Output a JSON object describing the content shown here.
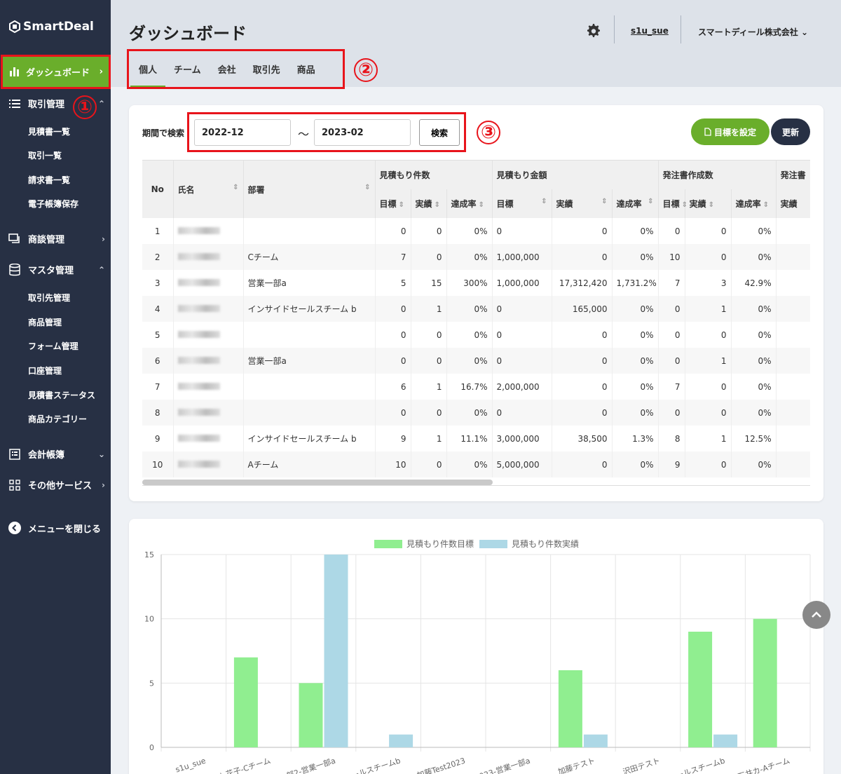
{
  "app": {
    "logo": "SmartDeal"
  },
  "sidebar": {
    "dashboard": "ダッシュボード",
    "deals_mgmt": "取引管理",
    "deals_subs": [
      "見積書一覧",
      "取引一覧",
      "請求書一覧",
      "電子帳簿保存"
    ],
    "negotiation": "商談管理",
    "master": "マスタ管理",
    "master_subs": [
      "取引先管理",
      "商品管理",
      "フォーム管理",
      "口座管理",
      "見積書ステータス",
      "商品カテゴリー"
    ],
    "accounting": "会計帳簿",
    "other": "その他サービス",
    "close": "メニューを閉じる"
  },
  "annotations": {
    "n1": "①",
    "n2": "②",
    "n3": "③"
  },
  "header": {
    "title": "ダッシュボード",
    "user": "s1u_sue",
    "company": "スマートディール株式会社"
  },
  "tabs": [
    "個人",
    "チーム",
    "会社",
    "取引先",
    "商品"
  ],
  "filter": {
    "label": "期間で検索",
    "from": "2022-12",
    "tilde": "〜",
    "to": "2023-02",
    "search": "検索",
    "goal": "目標を設定",
    "update": "更新"
  },
  "table": {
    "h_no": "No",
    "h_name": "氏名",
    "h_dept": "部署",
    "groups": [
      "見積もり件数",
      "見積もり金額",
      "発注書作成数",
      "発注書"
    ],
    "sub": [
      "目標",
      "実績",
      "達成率",
      "目標",
      "実績",
      "達成率",
      "目標",
      "実績",
      "達成率",
      "実績"
    ],
    "rows": [
      {
        "no": "1",
        "dept": "",
        "c": [
          "0",
          "0",
          "0%",
          "0",
          "0",
          "0%",
          "0",
          "0",
          "0%",
          ""
        ]
      },
      {
        "no": "2",
        "dept": "Cチーム",
        "c": [
          "7",
          "0",
          "0%",
          "1,000,000",
          "0",
          "0%",
          "10",
          "0",
          "0%",
          ""
        ]
      },
      {
        "no": "3",
        "dept": "営業一部a",
        "c": [
          "5",
          "15",
          "300%",
          "1,000,000",
          "17,312,420",
          "1,731.2%",
          "7",
          "3",
          "42.9%",
          ""
        ]
      },
      {
        "no": "4",
        "dept": "インサイドセールスチーム b",
        "c": [
          "0",
          "1",
          "0%",
          "0",
          "165,000",
          "0%",
          "0",
          "1",
          "0%",
          ""
        ]
      },
      {
        "no": "5",
        "dept": "",
        "c": [
          "0",
          "0",
          "0%",
          "0",
          "0",
          "0%",
          "0",
          "0",
          "0%",
          ""
        ]
      },
      {
        "no": "6",
        "dept": "営業一部a",
        "c": [
          "0",
          "0",
          "0%",
          "0",
          "0",
          "0%",
          "0",
          "1",
          "0%",
          ""
        ]
      },
      {
        "no": "7",
        "dept": "",
        "c": [
          "6",
          "1",
          "16.7%",
          "2,000,000",
          "0",
          "0%",
          "7",
          "0",
          "0%",
          ""
        ]
      },
      {
        "no": "8",
        "dept": "",
        "c": [
          "0",
          "0",
          "0%",
          "0",
          "0",
          "0%",
          "0",
          "0",
          "0%",
          ""
        ]
      },
      {
        "no": "9",
        "dept": "インサイドセールスチーム b",
        "c": [
          "9",
          "1",
          "11.1%",
          "3,000,000",
          "38,500",
          "1.3%",
          "8",
          "1",
          "12.5%",
          ""
        ]
      },
      {
        "no": "10",
        "dept": "Aチーム",
        "c": [
          "10",
          "0",
          "0%",
          "5,000,000",
          "0",
          "0%",
          "9",
          "0",
          "0%",
          ""
        ]
      }
    ]
  },
  "chart_data": {
    "type": "bar",
    "categories": [
      "s1u_sue",
      "…ト花子-Cチーム",
      "…部2-営業一部a",
      "…ールスチームb",
      "加藤Test2023",
      "…2023-営業一部a",
      "加藤テスト",
      "沢田テスト",
      "…ールスチームb",
      "…石井カ-Aチーム"
    ],
    "series": [
      {
        "name": "見積もり件数目標",
        "color": "#90ee90",
        "values": [
          0,
          7,
          5,
          0,
          0,
          0,
          6,
          0,
          9,
          10
        ]
      },
      {
        "name": "見積もり件数実績",
        "color": "#add8e6",
        "values": [
          0,
          0,
          15,
          1,
          0,
          0,
          1,
          0,
          1,
          0
        ]
      }
    ],
    "yticks": [
      0,
      5,
      10,
      15
    ],
    "ylim": [
      0,
      15
    ],
    "legend": "top-center",
    "grid": true
  }
}
